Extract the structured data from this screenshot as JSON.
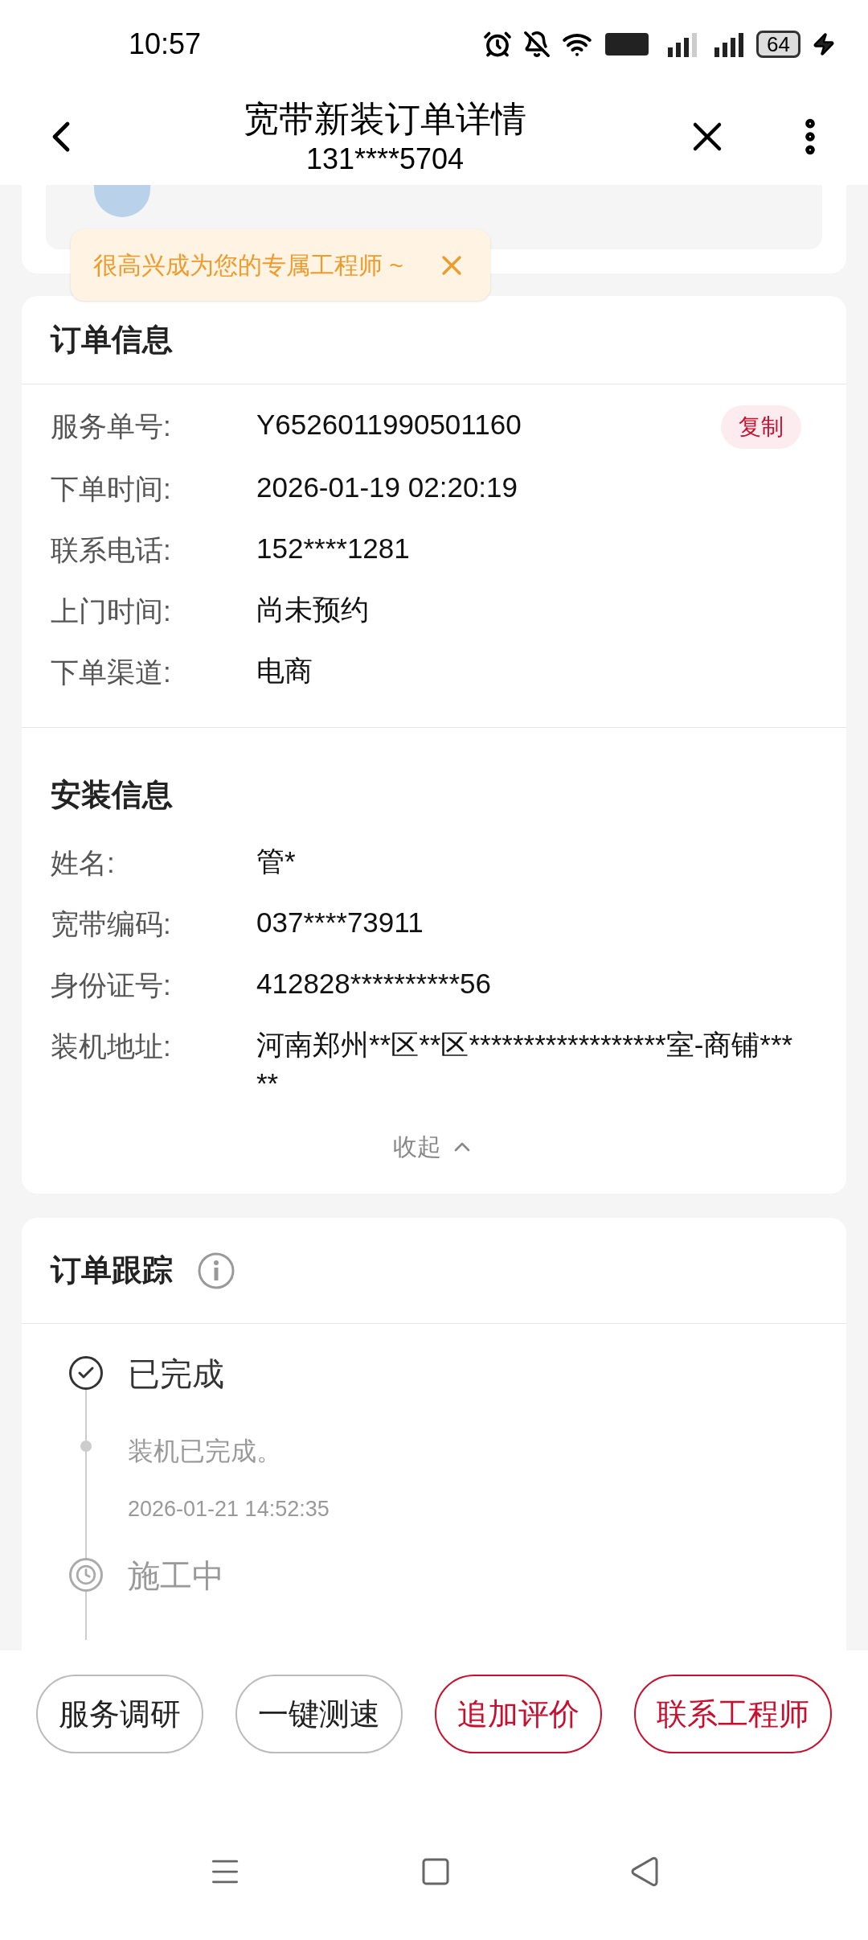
{
  "status_bar": {
    "time": "10:57",
    "battery": "64"
  },
  "header": {
    "title": "宽带新装订单详情",
    "subtitle": "131****5704"
  },
  "tooltip": {
    "text": "很高兴成为您的专属工程师 ~"
  },
  "order_info": {
    "title": "订单信息",
    "fields": [
      {
        "label": "服务单号:",
        "value": "Y6526011990501160",
        "action": "复制"
      },
      {
        "label": "下单时间:",
        "value": "2026-01-19 02:20:19"
      },
      {
        "label": "联系电话:",
        "value": "152****1281"
      },
      {
        "label": "上门时间:",
        "value": "尚未预约"
      },
      {
        "label": "下单渠道:",
        "value": "电商"
      }
    ]
  },
  "install_info": {
    "title": "安装信息",
    "fields": [
      {
        "label": "姓名:",
        "value": "管*"
      },
      {
        "label": "宽带编码:",
        "value": "037****73911"
      },
      {
        "label": "身份证号:",
        "value": "412828**********56"
      },
      {
        "label": "装机地址:",
        "value": "河南郑州**区**区******************室-商铺*****"
      }
    ],
    "collapse": "收起"
  },
  "tracking": {
    "title": "订单跟踪",
    "steps": [
      {
        "title": "已完成",
        "done": true,
        "description": "装机已完成。",
        "time": "2026-01-21 14:52:35"
      },
      {
        "title": "施工中",
        "done": false
      }
    ]
  },
  "actions": [
    {
      "label": "服务调研",
      "kind": "outline"
    },
    {
      "label": "一键测速",
      "kind": "outline"
    },
    {
      "label": "追加评价",
      "kind": "primary"
    },
    {
      "label": "联系工程师",
      "kind": "primary"
    }
  ]
}
